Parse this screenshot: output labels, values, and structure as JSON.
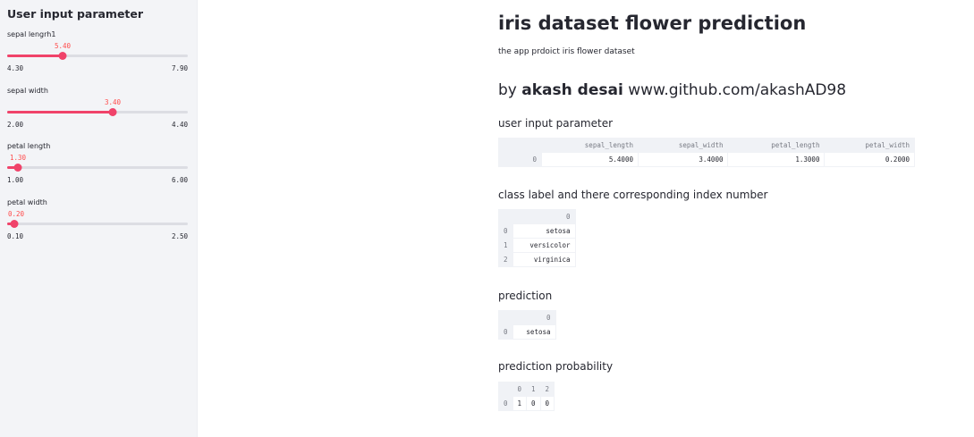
{
  "sidebar": {
    "title": "User input parameter",
    "sliders": [
      {
        "label": "sepal lengrh1",
        "value": "5.40",
        "min": "4.30",
        "max": "7.90",
        "fraction": 0.306
      },
      {
        "label": "sepal width",
        "value": "3.40",
        "min": "2.00",
        "max": "4.40",
        "fraction": 0.583
      },
      {
        "label": "petal length",
        "value": "1.30",
        "min": "1.00",
        "max": "6.00",
        "fraction": 0.06
      },
      {
        "label": "petal width",
        "value": "0.20",
        "min": "0.10",
        "max": "2.50",
        "fraction": 0.042
      }
    ]
  },
  "colors": {
    "accent": "#f0436a",
    "sidebar_bg": "#f3f4f7",
    "table_header_bg": "#f0f2f6"
  },
  "main": {
    "title": "iris dataset flower prediction",
    "caption": "the app prdoict iris flower dataset",
    "author_prefix": "by",
    "author_name": "akash desai",
    "author_link": "www.github.com/akashAD98",
    "sections": {
      "input": "user input parameter",
      "classes": "class label and there corresponding index number",
      "prediction": "prediction",
      "probability": "prediction probability"
    },
    "input_table": {
      "columns": [
        "sepal_length",
        "sepal_width",
        "petal_length",
        "petal_width"
      ],
      "rows": [
        {
          "index": "0",
          "cells": [
            "5.4000",
            "3.4000",
            "1.3000",
            "0.2000"
          ]
        }
      ]
    },
    "class_table": {
      "columns": [
        "0"
      ],
      "rows": [
        {
          "index": "0",
          "cells": [
            "setosa"
          ]
        },
        {
          "index": "1",
          "cells": [
            "versicolor"
          ]
        },
        {
          "index": "2",
          "cells": [
            "virginica"
          ]
        }
      ]
    },
    "prediction_table": {
      "columns": [
        "0"
      ],
      "rows": [
        {
          "index": "0",
          "cells": [
            "setosa"
          ]
        }
      ]
    },
    "probability_table": {
      "columns": [
        "0",
        "1",
        "2"
      ],
      "rows": [
        {
          "index": "0",
          "cells": [
            "1",
            "0",
            "0"
          ]
        }
      ]
    }
  }
}
